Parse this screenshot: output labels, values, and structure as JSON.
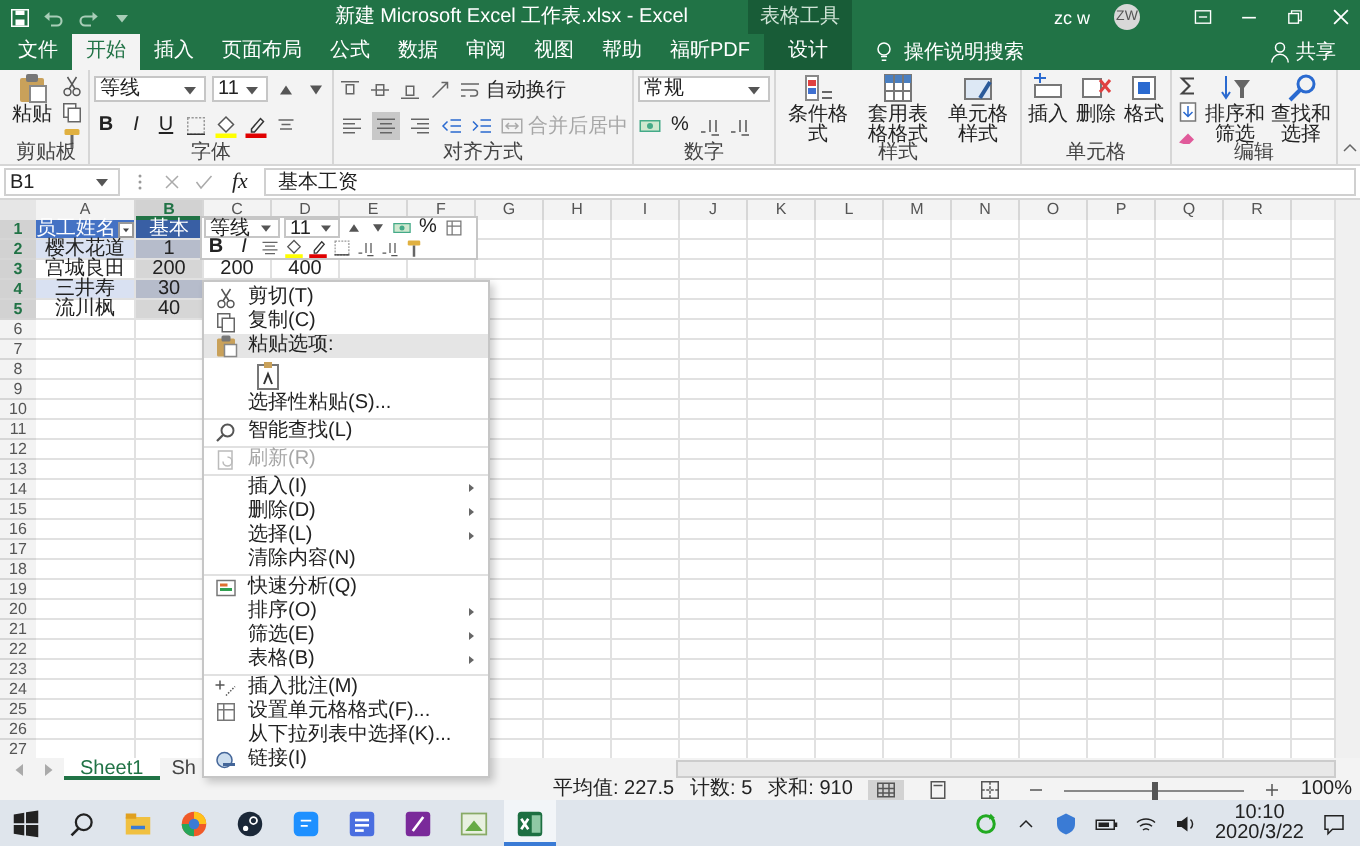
{
  "window": {
    "title": "新建 Microsoft Excel 工作表.xlsx - Excel",
    "context_label": "表格工具",
    "user": "zc w",
    "avatar": "ZW"
  },
  "tabs": [
    {
      "label": "文件",
      "selected": false,
      "contextual": false
    },
    {
      "label": "开始",
      "selected": true,
      "contextual": false
    },
    {
      "label": "插入",
      "selected": false,
      "contextual": false
    },
    {
      "label": "页面布局",
      "selected": false,
      "contextual": false
    },
    {
      "label": "公式",
      "selected": false,
      "contextual": false
    },
    {
      "label": "数据",
      "selected": false,
      "contextual": false
    },
    {
      "label": "审阅",
      "selected": false,
      "contextual": false
    },
    {
      "label": "视图",
      "selected": false,
      "contextual": false
    },
    {
      "label": "帮助",
      "selected": false,
      "contextual": false
    },
    {
      "label": "福昕PDF",
      "selected": false,
      "contextual": false
    },
    {
      "label": "设计",
      "selected": false,
      "contextual": true
    }
  ],
  "tell_me": "操作说明搜索",
  "share": "共享",
  "ribbon": [
    {
      "kind": "clipboard",
      "title": "剪贴板",
      "paste": "粘贴"
    },
    {
      "kind": "font",
      "title": "字体",
      "font": "等线",
      "size": "11",
      "bold": "B",
      "italic": "I",
      "underline": "U"
    },
    {
      "kind": "alignment",
      "title": "对齐方式",
      "wrap": "自动换行",
      "merge": "合并后居中",
      "merge_disabled": true,
      "align": [
        {
          "kind": "left",
          "selected": false
        },
        {
          "kind": "center",
          "selected": true
        },
        {
          "kind": "right",
          "selected": false
        }
      ]
    },
    {
      "kind": "number",
      "title": "数字",
      "format": "常规",
      "percent": "%"
    },
    {
      "kind": "styles",
      "title": "样式",
      "buttons": [
        {
          "kind": "conditional",
          "label": "条件格式"
        },
        {
          "kind": "table",
          "label": "套用表格格式"
        },
        {
          "kind": "cellstyle",
          "label": "单元格样式"
        }
      ]
    },
    {
      "kind": "cells",
      "title": "单元格",
      "buttons": [
        {
          "kind": "insert",
          "label": "插入"
        },
        {
          "kind": "delete",
          "label": "删除"
        },
        {
          "kind": "format",
          "label": "格式"
        }
      ]
    },
    {
      "kind": "editing",
      "title": "编辑",
      "buttons": [
        {
          "kind": "sort",
          "label": "排序和筛选"
        },
        {
          "kind": "find",
          "label": "查找和选择"
        }
      ]
    }
  ],
  "formula_bar": {
    "name_box": "B1",
    "fx": "fx",
    "value": "基本工资"
  },
  "columns": [
    {
      "label": "A",
      "selected": false
    },
    {
      "label": "B",
      "selected": true
    },
    {
      "label": "C",
      "selected": false
    },
    {
      "label": "D",
      "selected": false
    },
    {
      "label": "E",
      "selected": false
    },
    {
      "label": "F",
      "selected": false
    },
    {
      "label": "G",
      "selected": false
    },
    {
      "label": "H",
      "selected": false
    },
    {
      "label": "I",
      "selected": false
    },
    {
      "label": "J",
      "selected": false
    },
    {
      "label": "K",
      "selected": false
    },
    {
      "label": "L",
      "selected": false
    },
    {
      "label": "M",
      "selected": false
    },
    {
      "label": "N",
      "selected": false
    },
    {
      "label": "O",
      "selected": false
    },
    {
      "label": "P",
      "selected": false
    },
    {
      "label": "Q",
      "selected": false
    },
    {
      "label": "R",
      "selected": false
    }
  ],
  "rows": [
    {
      "label": "1",
      "selected": true,
      "cells": [
        {
          "text": "员工姓名",
          "kind": "header",
          "banded": false,
          "selected": false,
          "filter": true
        },
        {
          "text": "基本",
          "kind": "header",
          "banded": false,
          "selected": true,
          "filter": false
        }
      ]
    },
    {
      "label": "2",
      "selected": true,
      "cells": [
        {
          "text": "樱木花道",
          "kind": "table",
          "banded": true,
          "selected": false,
          "filter": false
        },
        {
          "text": "1",
          "kind": "table",
          "banded": true,
          "selected": true,
          "filter": false
        }
      ]
    },
    {
      "label": "3",
      "selected": true,
      "cells": [
        {
          "text": "宫城良田",
          "kind": "table",
          "banded": false,
          "selected": false,
          "filter": false
        },
        {
          "text": "200",
          "kind": "table",
          "banded": false,
          "selected": true,
          "filter": false
        },
        {
          "text": "200",
          "kind": "plain",
          "banded": false,
          "selected": false,
          "filter": false
        },
        {
          "text": "400",
          "kind": "plain",
          "banded": false,
          "selected": false,
          "filter": false
        }
      ]
    },
    {
      "label": "4",
      "selected": true,
      "cells": [
        {
          "text": "三井寿",
          "kind": "table",
          "banded": true,
          "selected": false,
          "filter": false
        },
        {
          "text": "30",
          "kind": "table",
          "banded": true,
          "selected": true,
          "filter": false
        }
      ]
    },
    {
      "label": "5",
      "selected": true,
      "cells": [
        {
          "text": "流川枫",
          "kind": "table",
          "banded": false,
          "selected": false,
          "filter": false
        },
        {
          "text": "40",
          "kind": "table",
          "banded": false,
          "selected": true,
          "filter": false
        }
      ]
    },
    {
      "label": "6",
      "selected": false
    },
    {
      "label": "7",
      "selected": false
    },
    {
      "label": "8",
      "selected": false
    },
    {
      "label": "9",
      "selected": false
    },
    {
      "label": "10",
      "selected": false
    },
    {
      "label": "11",
      "selected": false
    },
    {
      "label": "12",
      "selected": false
    },
    {
      "label": "13",
      "selected": false
    },
    {
      "label": "14",
      "selected": false
    },
    {
      "label": "15",
      "selected": false
    },
    {
      "label": "16",
      "selected": false
    },
    {
      "label": "17",
      "selected": false
    },
    {
      "label": "18",
      "selected": false
    },
    {
      "label": "19",
      "selected": false
    },
    {
      "label": "20",
      "selected": false
    },
    {
      "label": "21",
      "selected": false
    },
    {
      "label": "22",
      "selected": false
    },
    {
      "label": "23",
      "selected": false
    },
    {
      "label": "24",
      "selected": false
    },
    {
      "label": "25",
      "selected": false
    },
    {
      "label": "26",
      "selected": false
    },
    {
      "label": "27",
      "selected": false
    }
  ],
  "mini_toolbar": {
    "font": "等线",
    "size": "11",
    "bold": "B",
    "italic": "I",
    "percent": "%"
  },
  "menu": [
    {
      "kind": "cut",
      "label": "剪切(T)",
      "selected": false,
      "disabled": false,
      "submenu": false,
      "divider": false
    },
    {
      "kind": "copy",
      "label": "复制(C)",
      "selected": false,
      "disabled": false,
      "submenu": false,
      "divider": false
    },
    {
      "kind": "paste",
      "label": "粘贴选项:",
      "selected": true,
      "disabled": false,
      "submenu": false,
      "divider": false
    },
    {
      "kind": "paste-icons",
      "selected": false,
      "disabled": false,
      "submenu": false,
      "divider": false
    },
    {
      "kind": "plain",
      "label": "选择性粘贴(S)...",
      "selected": false,
      "disabled": false,
      "submenu": false,
      "divider": false
    },
    {
      "kind": "lookup",
      "label": "智能查找(L)",
      "selected": false,
      "disabled": false,
      "submenu": false,
      "divider": true
    },
    {
      "kind": "refresh",
      "label": "刷新(R)",
      "selected": false,
      "disabled": true,
      "submenu": false,
      "divider": true
    },
    {
      "kind": "plain",
      "label": "插入(I)",
      "selected": false,
      "disabled": false,
      "submenu": true,
      "divider": true
    },
    {
      "kind": "plain",
      "label": "删除(D)",
      "selected": false,
      "disabled": false,
      "submenu": true,
      "divider": false
    },
    {
      "kind": "plain",
      "label": "选择(L)",
      "selected": false,
      "disabled": false,
      "submenu": true,
      "divider": false
    },
    {
      "kind": "plain",
      "label": "清除内容(N)",
      "selected": false,
      "disabled": false,
      "submenu": false,
      "divider": false
    },
    {
      "kind": "analysis",
      "label": "快速分析(Q)",
      "selected": false,
      "disabled": false,
      "submenu": false,
      "divider": true
    },
    {
      "kind": "plain",
      "label": "排序(O)",
      "selected": false,
      "disabled": false,
      "submenu": true,
      "divider": false
    },
    {
      "kind": "plain",
      "label": "筛选(E)",
      "selected": false,
      "disabled": false,
      "submenu": true,
      "divider": false
    },
    {
      "kind": "plain",
      "label": "表格(B)",
      "selected": false,
      "disabled": false,
      "submenu": true,
      "divider": false
    },
    {
      "kind": "comment",
      "label": "插入批注(M)",
      "selected": false,
      "disabled": false,
      "submenu": false,
      "divider": true
    },
    {
      "kind": "format",
      "label": "设置单元格格式(F)...",
      "selected": false,
      "disabled": false,
      "submenu": false,
      "divider": false
    },
    {
      "kind": "plain",
      "label": "从下拉列表中选择(K)...",
      "selected": false,
      "disabled": false,
      "submenu": false,
      "divider": false
    },
    {
      "kind": "link",
      "label": "链接(I)",
      "selected": false,
      "disabled": false,
      "submenu": false,
      "divider": false
    }
  ],
  "sheets": [
    {
      "label": "Sheet1",
      "selected": true
    },
    {
      "label": "Sh",
      "selected": false
    }
  ],
  "status": {
    "stats": [
      "平均值: 227.5",
      "计数: 5",
      "求和: 910"
    ],
    "views": [
      {
        "kind": "normal",
        "selected": true
      },
      {
        "kind": "layout",
        "selected": false
      },
      {
        "kind": "break",
        "selected": false
      }
    ],
    "zoom": {
      "level": 0.5,
      "label": "100%"
    }
  },
  "taskbar": {
    "apps": [
      {
        "kind": "explorer",
        "active": false
      },
      {
        "kind": "browser",
        "active": false
      },
      {
        "kind": "steam",
        "active": false
      },
      {
        "kind": "chat",
        "active": false
      },
      {
        "kind": "writer",
        "active": false
      },
      {
        "kind": "notes",
        "active": false
      },
      {
        "kind": "paint",
        "active": false
      },
      {
        "kind": "excel",
        "active": true
      }
    ],
    "time": "10:10",
    "date": "2020/3/22"
  }
}
